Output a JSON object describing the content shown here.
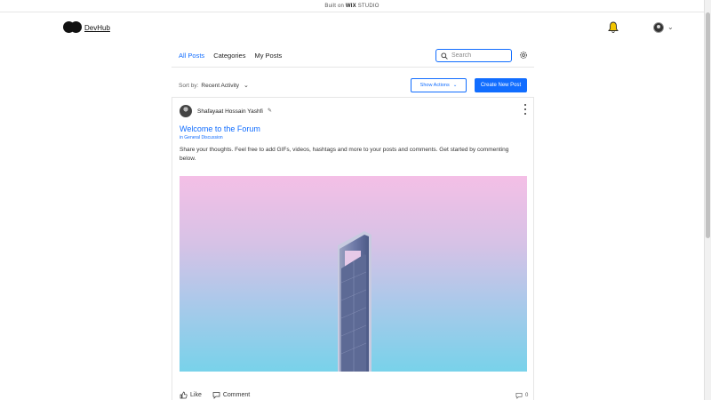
{
  "topbar": {
    "built_prefix": "Built on",
    "built_brand": "WIX",
    "built_suffix": "STUDIO"
  },
  "site": {
    "name": "DevHub"
  },
  "nav": {
    "tabs": [
      {
        "label": "All Posts",
        "active": true
      },
      {
        "label": "Categories",
        "active": false
      },
      {
        "label": "My Posts",
        "active": false
      }
    ]
  },
  "search": {
    "placeholder": "Search"
  },
  "toolbar": {
    "sort_label": "Sort by:",
    "sort_value": "Recent Activity",
    "show_button": "Show Actions",
    "create_button": "Create New Post"
  },
  "post": {
    "author": "Shafayaat Hossain Yashfi",
    "title": "Welcome to the Forum",
    "category": "in General Discussion",
    "body": "Share your thoughts. Feel free to add GIFs, videos, hashtags and more to your posts and comments. Get started by commenting below.",
    "like_label": "Like",
    "comment_label": "Comment",
    "comment_count": "0"
  },
  "icons": [
    "logo-icon",
    "bell-icon",
    "avatar",
    "chevron-down-icon",
    "search-icon",
    "gear-icon",
    "pen-icon",
    "kebab-icon",
    "like-icon",
    "comment-icon"
  ],
  "colors": {
    "accent": "#116dff",
    "bell": "#f2c500"
  }
}
